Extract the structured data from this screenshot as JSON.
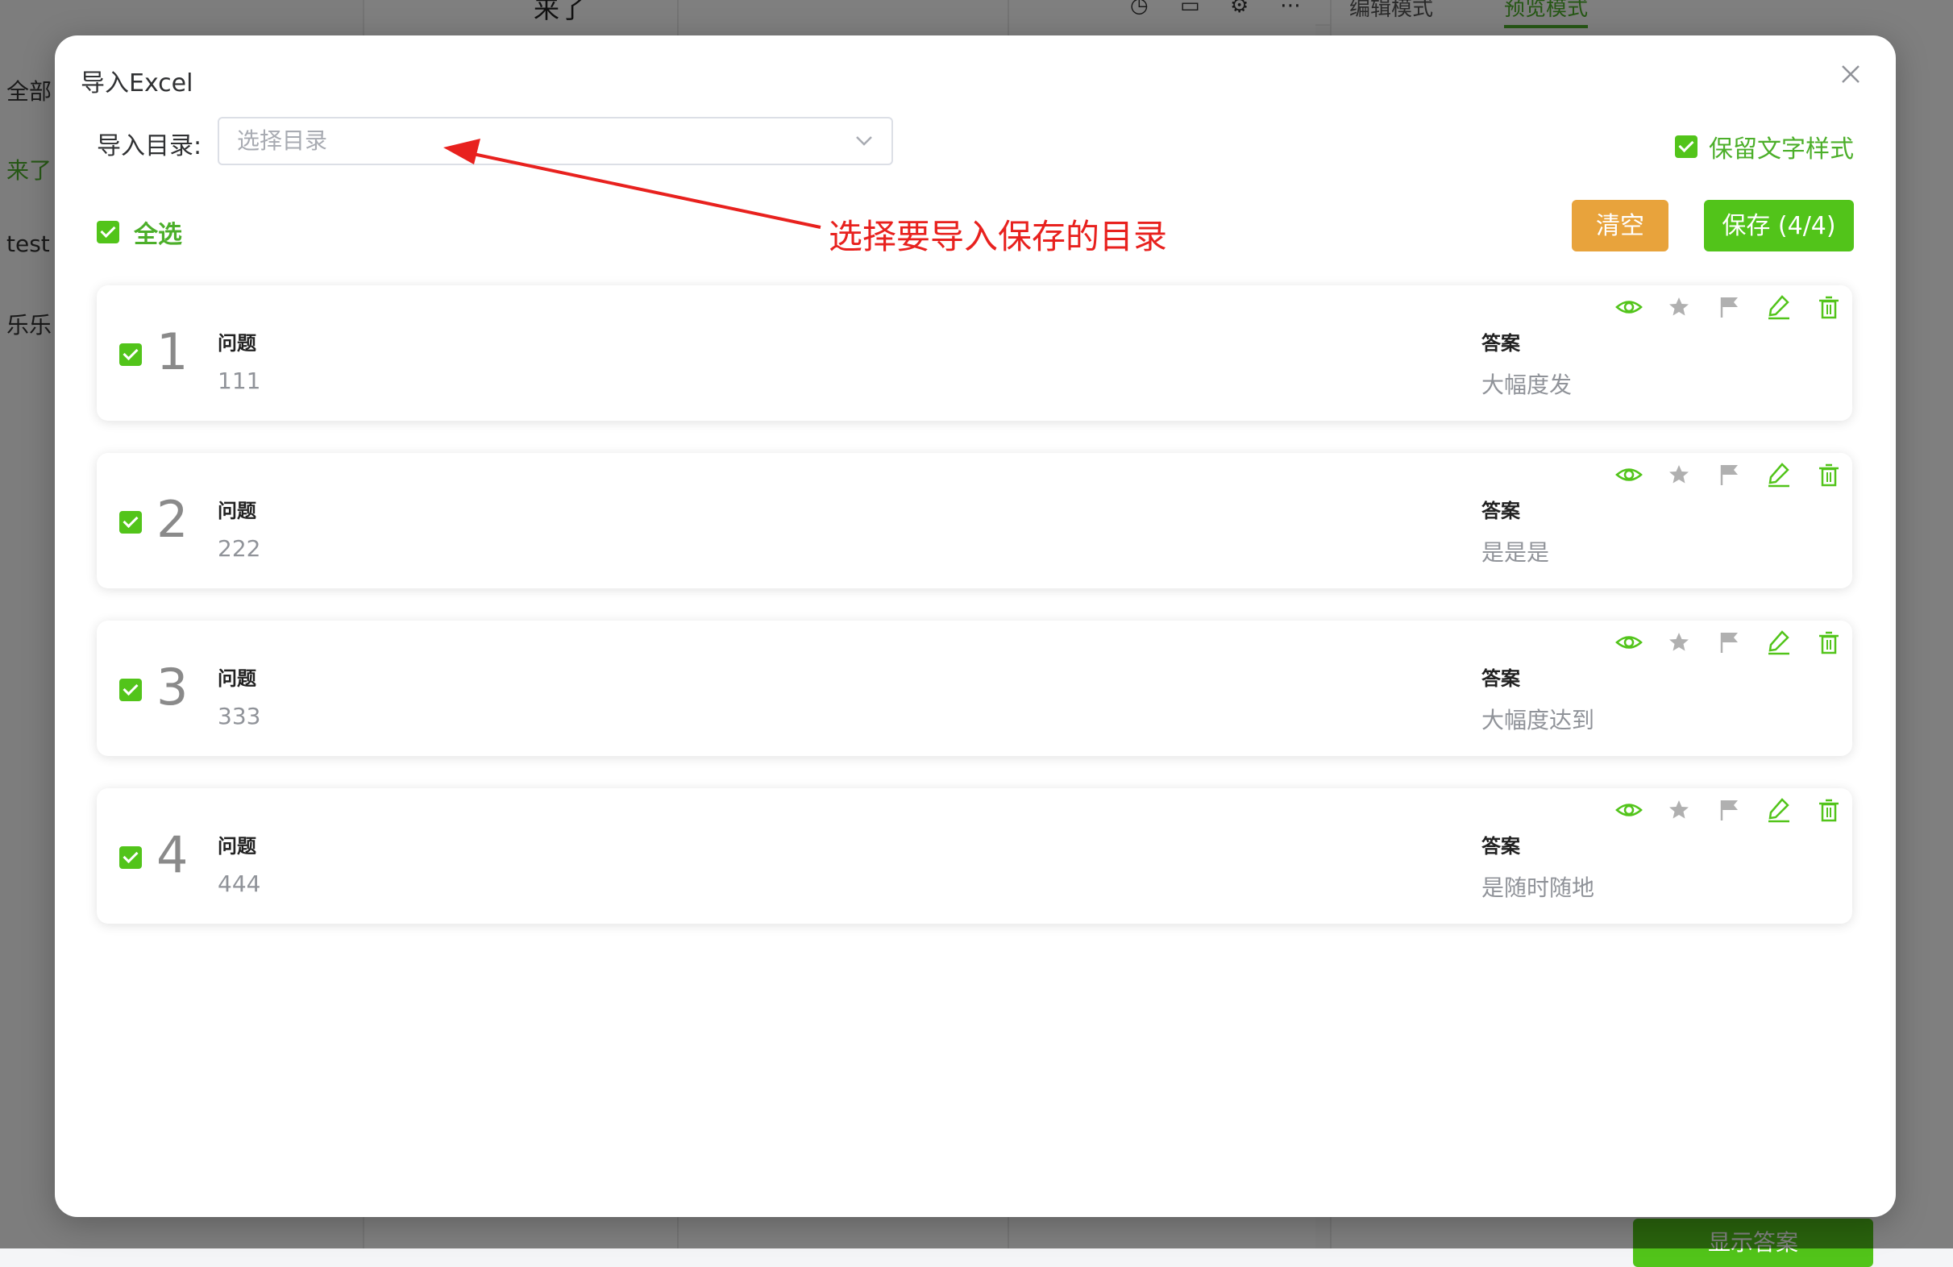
{
  "background": {
    "sidebar_items": [
      "全部",
      "来了",
      "test",
      "乐乐"
    ],
    "title": "来了",
    "mode_tabs": [
      "编辑模式",
      "预览模式"
    ],
    "show_answer_button": "显示答案"
  },
  "modal": {
    "title": "导入Excel",
    "directory_label": "导入目录:",
    "directory_placeholder": "选择目录",
    "keep_style_label": "保留文字样式",
    "select_all_label": "全选",
    "clear_button": "清空",
    "save_button": "保存 (4/4)",
    "annotation": "选择要导入保存的目录",
    "question_label": "问题",
    "answer_label": "答案",
    "items": [
      {
        "index": "1",
        "question": "111",
        "answer": "大幅度发"
      },
      {
        "index": "2",
        "question": "222",
        "answer": "是是是"
      },
      {
        "index": "3",
        "question": "333",
        "answer": "大幅度达到"
      },
      {
        "index": "4",
        "question": "444",
        "answer": "是随时随地"
      }
    ]
  },
  "colors": {
    "accent_green": "#52c41a",
    "clear_orange": "#e8a33c",
    "annotation_red": "#e8211e"
  },
  "icons": [
    "eye-icon",
    "star-icon",
    "flag-icon",
    "edit-icon",
    "delete-icon",
    "close-icon",
    "chevron-down-icon"
  ]
}
